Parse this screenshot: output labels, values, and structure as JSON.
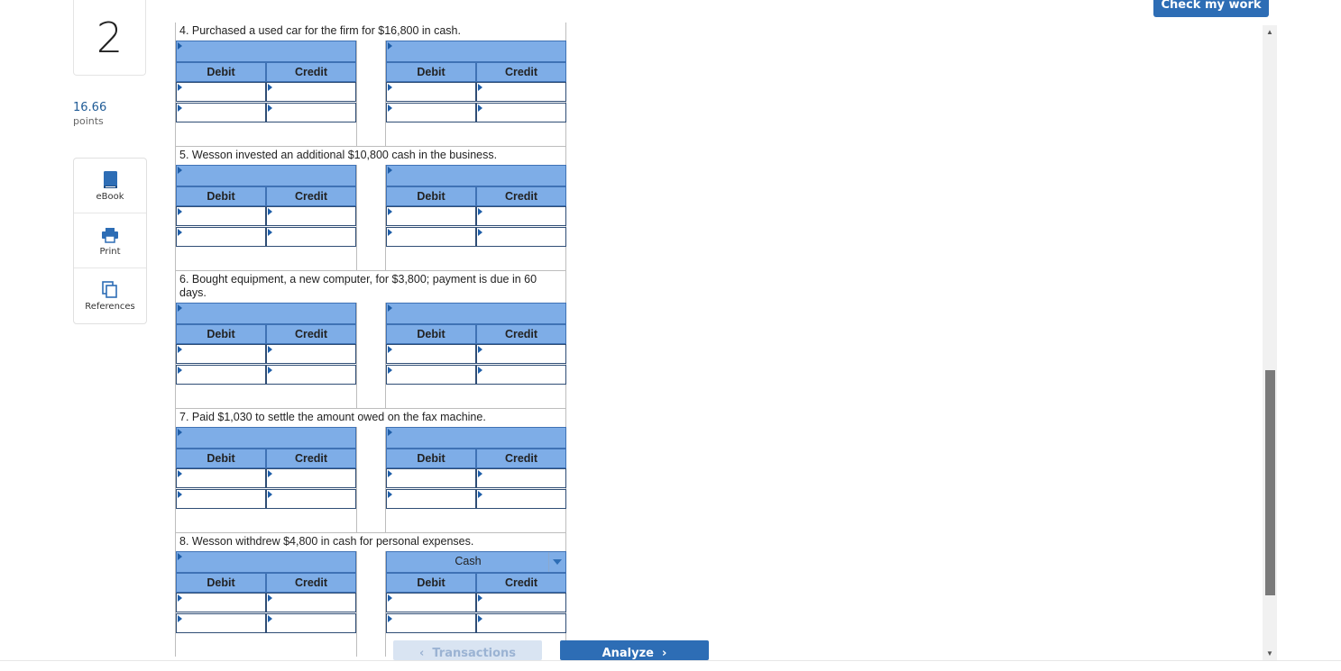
{
  "question": {
    "number": "2",
    "points_value": "16.66",
    "points_label": "points"
  },
  "tools": [
    {
      "label": "eBook",
      "icon": "book-icon"
    },
    {
      "label": "Print",
      "icon": "printer-icon"
    },
    {
      "label": "References",
      "icon": "copy-icon"
    }
  ],
  "check_button": "Check my work",
  "columns": {
    "debit": "Debit",
    "credit": "Credit"
  },
  "entries": [
    {
      "desc": "4. Purchased a used car for the firm for $16,800 in cash.",
      "left_account": "",
      "right_account": ""
    },
    {
      "desc": "5. Wesson invested an additional $10,800 cash in the business.",
      "left_account": "",
      "right_account": ""
    },
    {
      "desc": "6. Bought equipment, a new computer, for $3,800; payment is due in 60 days.",
      "left_account": "",
      "right_account": ""
    },
    {
      "desc": "7. Paid $1,030 to settle the amount owed on the fax machine.",
      "left_account": "",
      "right_account": ""
    },
    {
      "desc": "8. Wesson withdrew $4,800 in cash for personal expenses.",
      "left_account": "",
      "right_account": "Cash"
    }
  ],
  "nav": {
    "prev_label": "Transactions",
    "next_label": "Analyze"
  },
  "colors": {
    "accent": "#2d6db5",
    "cell_header": "#7eade7"
  }
}
